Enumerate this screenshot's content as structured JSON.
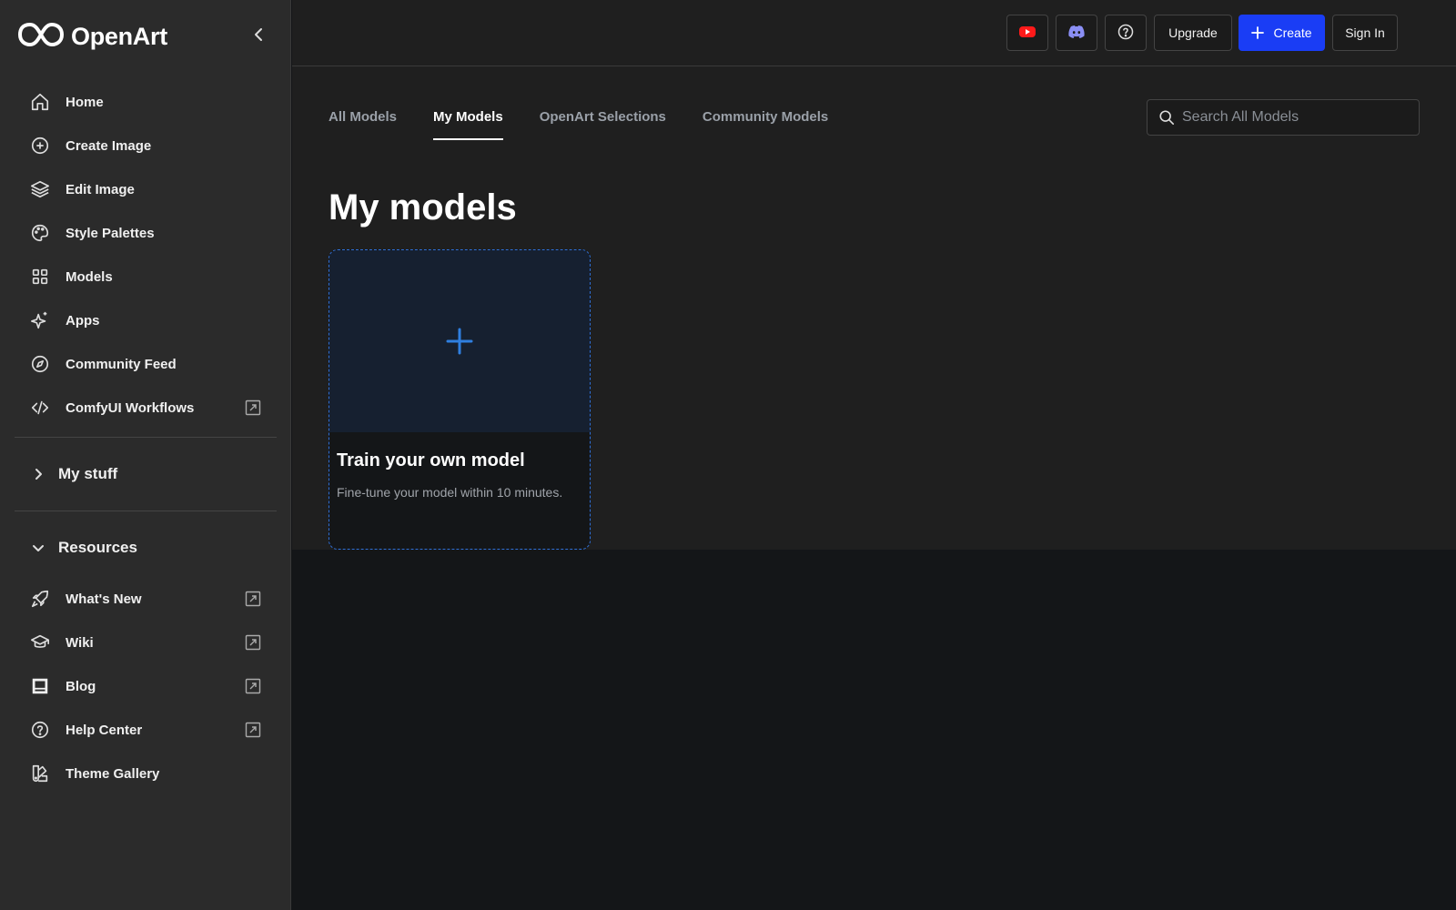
{
  "brand": {
    "name": "OpenArt"
  },
  "sidebar": {
    "items": [
      {
        "label": "Home",
        "icon": "home-icon"
      },
      {
        "label": "Create Image",
        "icon": "plus-circle-icon"
      },
      {
        "label": "Edit Image",
        "icon": "layers-icon"
      },
      {
        "label": "Style Palettes",
        "icon": "palette-icon"
      },
      {
        "label": "Models",
        "icon": "grid-icon"
      },
      {
        "label": "Apps",
        "icon": "sparkles-icon"
      },
      {
        "label": "Community Feed",
        "icon": "compass-icon"
      },
      {
        "label": "ComfyUI Workflows",
        "icon": "code-icon",
        "external": true
      }
    ],
    "my_stuff": {
      "label": "My stuff",
      "expanded": false
    },
    "resources": {
      "label": "Resources",
      "expanded": true,
      "items": [
        {
          "label": "What's New",
          "icon": "rocket-icon",
          "external": true
        },
        {
          "label": "Wiki",
          "icon": "graduation-cap-icon",
          "external": true
        },
        {
          "label": "Blog",
          "icon": "blog-icon",
          "external": true
        },
        {
          "label": "Help Center",
          "icon": "help-circle-icon",
          "external": true
        },
        {
          "label": "Theme Gallery",
          "icon": "swatch-book-icon"
        }
      ]
    }
  },
  "topbar": {
    "youtube_icon": "youtube-icon",
    "discord_icon": "discord-icon",
    "help_icon": "help-circle-icon",
    "upgrade_label": "Upgrade",
    "create_label": "Create",
    "signin_label": "Sign In",
    "accent": "#1a3df5"
  },
  "tabs": [
    {
      "label": "All Models",
      "active": false
    },
    {
      "label": "My Models",
      "active": true
    },
    {
      "label": "OpenArt Selections",
      "active": false
    },
    {
      "label": "Community Models",
      "active": false
    }
  ],
  "search": {
    "placeholder": "Search All Models",
    "value": ""
  },
  "page": {
    "title": "My models"
  },
  "card": {
    "title": "Train your own model",
    "description": "Fine-tune your model within 10 minutes.",
    "icon": "plus-icon",
    "accent": "#2f7fe0"
  }
}
